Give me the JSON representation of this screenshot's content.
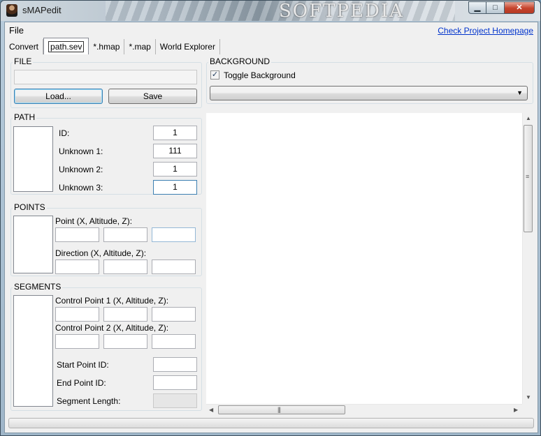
{
  "window": {
    "title": "sMAPedit",
    "watermark": "SOFTPEDIA",
    "controls": {
      "minimize": "▁",
      "maximize": "□",
      "close": "✕"
    }
  },
  "menu": {
    "file": "File",
    "homepage_link": "Check Project Homepage"
  },
  "tabs": [
    {
      "label": "Convert"
    },
    {
      "label": "path.sev",
      "active": true
    },
    {
      "label": "*.hmap"
    },
    {
      "label": "*.map"
    },
    {
      "label": "World Explorer"
    }
  ],
  "file_group": {
    "title": "FILE",
    "path_value": "",
    "load_label": "Load...",
    "save_label": "Save"
  },
  "path_group": {
    "title": "PATH",
    "fields": [
      {
        "label": "ID:",
        "value": "1"
      },
      {
        "label": "Unknown 1:",
        "value": "111"
      },
      {
        "label": "Unknown 2:",
        "value": "1"
      },
      {
        "label": "Unknown 3:",
        "value": "1"
      }
    ]
  },
  "points_group": {
    "title": "POINTS",
    "point_label": "Point (X, Altitude, Z):",
    "direction_label": "Direction (X, Altitude, Z):"
  },
  "segments_group": {
    "title": "SEGMENTS",
    "control1_label": "Control Point 1 (X, Altitude, Z):",
    "control2_label": "Control Point 2 (X, Altitude, Z):",
    "start_label": "Start Point ID:",
    "end_label": "End Point ID:",
    "length_label": "Segment Length:"
  },
  "background_group": {
    "title": "BACKGROUND",
    "toggle_label": "Toggle Background",
    "toggle_checked": true,
    "checkmark": "✓",
    "combo_value": ""
  },
  "scroll": {
    "up": "▲",
    "down": "▼",
    "left": "◀",
    "right": "▶",
    "grip_v": "≡",
    "grip_h": "|||"
  }
}
